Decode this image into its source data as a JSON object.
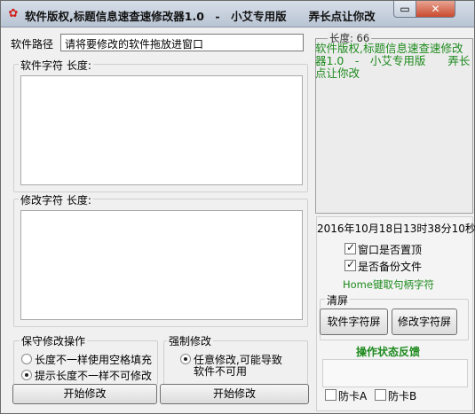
{
  "window": {
    "title": "软件版权,标题信息速查速修改器1.0　-　小艾专用版　　弄长点让你改",
    "minimize_symbol": "▭",
    "close_symbol": "✕"
  },
  "path": {
    "label": "软件路径",
    "value": "请将要修改的软件拖放进窗口"
  },
  "original_chars": {
    "label": "软件字符 长度:"
  },
  "modified_chars": {
    "label": "修改字符 长度:"
  },
  "preview": {
    "length_label": "长度: 66",
    "text": "软件版权,标题信息速查速修改器1.0　-　小艾专用版　　弄长点让你改"
  },
  "datetime": "2016年10月18日13时38分10秒",
  "options": {
    "topmost_label": "窗口是否置顶",
    "topmost_checked": true,
    "backup_label": "是否备份文件",
    "backup_checked": true,
    "home_hint": "Home键取句柄字符"
  },
  "clear_group": {
    "label": "清屏",
    "clear_original_btn": "软件字符屏",
    "clear_modified_btn": "修改字符屏"
  },
  "status": {
    "label": "操作状态反馈",
    "anti_a_label": "防卡A",
    "anti_b_label": "防卡B"
  },
  "conservative": {
    "label": "保守修改操作",
    "option1": "长度不一样使用空格填充",
    "option2": "提示长度不一样不可修改",
    "selected": 2,
    "start_btn": "开始修改"
  },
  "forced": {
    "label": "强制修改",
    "option1_line1": "任意修改,可能导致",
    "option1_line2": "软件不可用",
    "start_btn": "开始修改"
  }
}
